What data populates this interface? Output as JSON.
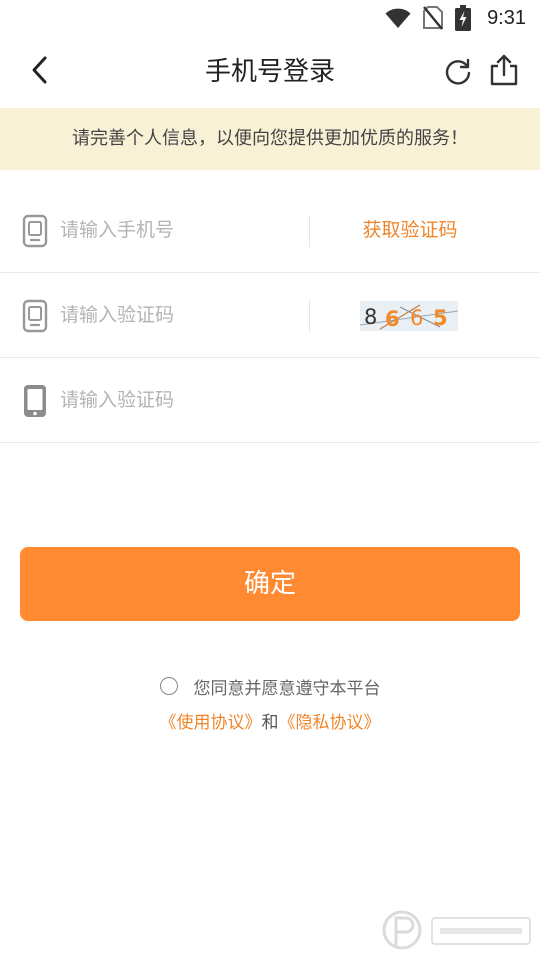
{
  "status_bar": {
    "time": "9:31",
    "icons": [
      "wifi-icon",
      "no-sim-icon",
      "battery-charging-icon"
    ]
  },
  "app_bar": {
    "title": "手机号登录",
    "back_icon": "chevron-left-icon",
    "refresh_icon": "refresh-icon",
    "share_icon": "share-icon"
  },
  "notice": {
    "text": "请完善个人信息，以便向您提供更加优质的服务！"
  },
  "form": {
    "phone": {
      "placeholder": "请输入手机号",
      "value": "",
      "icon": "phone-outline-icon",
      "get_code_label": "获取验证码"
    },
    "captcha": {
      "placeholder": "请输入验证码",
      "value": "",
      "icon": "phone-outline-icon",
      "captcha_text": "8665"
    },
    "sms_code": {
      "placeholder": "请输入验证码",
      "value": "",
      "icon": "phone-filled-icon"
    }
  },
  "confirm_label": "确定",
  "agreement": {
    "text": "您同意并愿意遵守本平台",
    "checked": false,
    "terms_link": "《使用协议》",
    "and_text": "和",
    "privacy_link": "《隐私协议》"
  },
  "colors": {
    "accent": "#ff8a32",
    "link": "#f0862b",
    "notice_bg": "#f8f1d6"
  }
}
